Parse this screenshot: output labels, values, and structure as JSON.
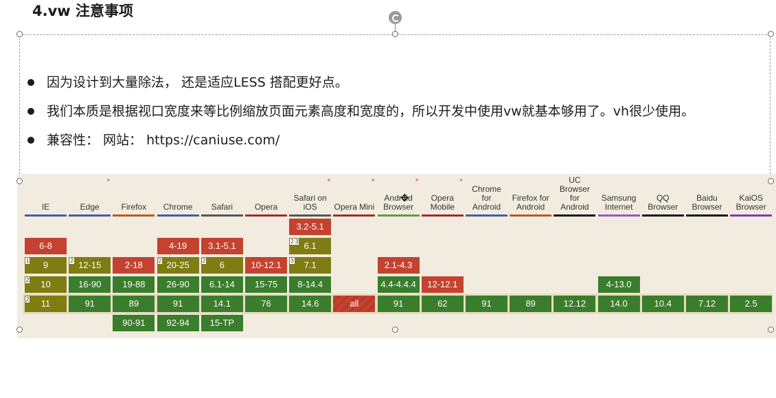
{
  "slide": {
    "title": "4.vw 注意事项",
    "bullets": [
      "因为设计到大量除法， 还是适应LESS 搭配更好点。",
      "我们本质是根据视口宽度来等比例缩放页面元素高度和宽度的，所以开发中使用vw就基本够用了。vh很少使用。",
      "兼容性：  网站：  https://caniuse.com/"
    ]
  },
  "caniuse": {
    "colors": {
      "red": "#c44230",
      "olive": "#7f7c12",
      "green": "#3a7d2c"
    },
    "browsers": [
      {
        "name": "IE",
        "underline": "#3e5fa3",
        "star": false
      },
      {
        "name": "Edge",
        "underline": "#3e5fa3",
        "star": true
      },
      {
        "name": "Firefox",
        "underline": "#b85b1b",
        "star": false
      },
      {
        "name": "Chrome",
        "underline": "#3e5fa3",
        "star": false
      },
      {
        "name": "Safari",
        "underline": "#555555",
        "star": false
      },
      {
        "name": "Opera",
        "underline": "#a22b26",
        "star": false
      },
      {
        "name": "Safari on iOS",
        "underline": "#555555",
        "star": true
      },
      {
        "name": "Opera Mini",
        "underline": "#a22b26",
        "star": true
      },
      {
        "name": "Android Browser",
        "underline": "#5f9e3a",
        "star": true
      },
      {
        "name": "Opera Mobile",
        "underline": "#a22b26",
        "star": true
      },
      {
        "name": "Chrome for Android",
        "underline": "#3e5fa3",
        "star": false
      },
      {
        "name": "Firefox for Android",
        "underline": "#b85b1b",
        "star": false
      },
      {
        "name": "UC Browser for Android",
        "underline": "#111111",
        "star": false
      },
      {
        "name": "Samsung Internet",
        "underline": "#8a5cc9",
        "star": false
      },
      {
        "name": "QQ Browser",
        "underline": "#111111",
        "star": false
      },
      {
        "name": "Baidu Browser",
        "underline": "#111111",
        "star": false
      },
      {
        "name": "KaiOS Browser",
        "underline": "#7d3cb5",
        "star": false
      }
    ],
    "cells": [
      {
        "col": 6,
        "row": 0,
        "text": "3.2-5.1",
        "status": "red"
      },
      {
        "col": 0,
        "row": 1,
        "text": "6-8",
        "status": "red"
      },
      {
        "col": 3,
        "row": 1,
        "text": "4-19",
        "status": "red"
      },
      {
        "col": 4,
        "row": 1,
        "text": "3.1-5.1",
        "status": "red"
      },
      {
        "col": 6,
        "row": 1,
        "text": "6.1",
        "status": "olive",
        "note": "2 3"
      },
      {
        "col": 0,
        "row": 2,
        "text": "9",
        "status": "olive",
        "note": "1"
      },
      {
        "col": 1,
        "row": 2,
        "text": "12-15",
        "status": "olive",
        "note": "2"
      },
      {
        "col": 2,
        "row": 2,
        "text": "2-18",
        "status": "red"
      },
      {
        "col": 3,
        "row": 2,
        "text": "20-25",
        "status": "olive",
        "note": "2"
      },
      {
        "col": 4,
        "row": 2,
        "text": "6",
        "status": "olive",
        "note": "2"
      },
      {
        "col": 5,
        "row": 2,
        "text": "10-12.1",
        "status": "red"
      },
      {
        "col": 6,
        "row": 2,
        "text": "7.1",
        "status": "olive",
        "note": "3"
      },
      {
        "col": 8,
        "row": 2,
        "text": "2.1-4.3",
        "status": "red"
      },
      {
        "col": 0,
        "row": 3,
        "text": "10",
        "status": "olive",
        "note": "2"
      },
      {
        "col": 1,
        "row": 3,
        "text": "16-90",
        "status": "green"
      },
      {
        "col": 2,
        "row": 3,
        "text": "19-88",
        "status": "green"
      },
      {
        "col": 3,
        "row": 3,
        "text": "26-90",
        "status": "green"
      },
      {
        "col": 4,
        "row": 3,
        "text": "6.1-14",
        "status": "green"
      },
      {
        "col": 5,
        "row": 3,
        "text": "15-75",
        "status": "green"
      },
      {
        "col": 6,
        "row": 3,
        "text": "8-14.4",
        "status": "green"
      },
      {
        "col": 8,
        "row": 3,
        "text": "4.4-4.4.4",
        "status": "green"
      },
      {
        "col": 9,
        "row": 3,
        "text": "12-12.1",
        "status": "red"
      },
      {
        "col": 13,
        "row": 3,
        "text": "4-13.0",
        "status": "green"
      },
      {
        "col": 0,
        "row": 4,
        "text": "11",
        "status": "olive",
        "note": "2"
      },
      {
        "col": 1,
        "row": 4,
        "text": "91",
        "status": "green"
      },
      {
        "col": 2,
        "row": 4,
        "text": "89",
        "status": "green"
      },
      {
        "col": 3,
        "row": 4,
        "text": "91",
        "status": "green"
      },
      {
        "col": 4,
        "row": 4,
        "text": "14.1",
        "status": "green"
      },
      {
        "col": 5,
        "row": 4,
        "text": "76",
        "status": "green"
      },
      {
        "col": 6,
        "row": 4,
        "text": "14.6",
        "status": "green"
      },
      {
        "col": 7,
        "row": 4,
        "text": "all",
        "status": "partial"
      },
      {
        "col": 8,
        "row": 4,
        "text": "91",
        "status": "green"
      },
      {
        "col": 9,
        "row": 4,
        "text": "62",
        "status": "green"
      },
      {
        "col": 10,
        "row": 4,
        "text": "91",
        "status": "green"
      },
      {
        "col": 11,
        "row": 4,
        "text": "89",
        "status": "green"
      },
      {
        "col": 12,
        "row": 4,
        "text": "12.12",
        "status": "green"
      },
      {
        "col": 13,
        "row": 4,
        "text": "14.0",
        "status": "green"
      },
      {
        "col": 14,
        "row": 4,
        "text": "10.4",
        "status": "green"
      },
      {
        "col": 15,
        "row": 4,
        "text": "7.12",
        "status": "green"
      },
      {
        "col": 16,
        "row": 4,
        "text": "2.5",
        "status": "green"
      },
      {
        "col": 2,
        "row": 5,
        "text": "90-91",
        "status": "green"
      },
      {
        "col": 3,
        "row": 5,
        "text": "92-94",
        "status": "green"
      },
      {
        "col": 4,
        "row": 5,
        "text": "15-TP",
        "status": "green"
      }
    ]
  }
}
